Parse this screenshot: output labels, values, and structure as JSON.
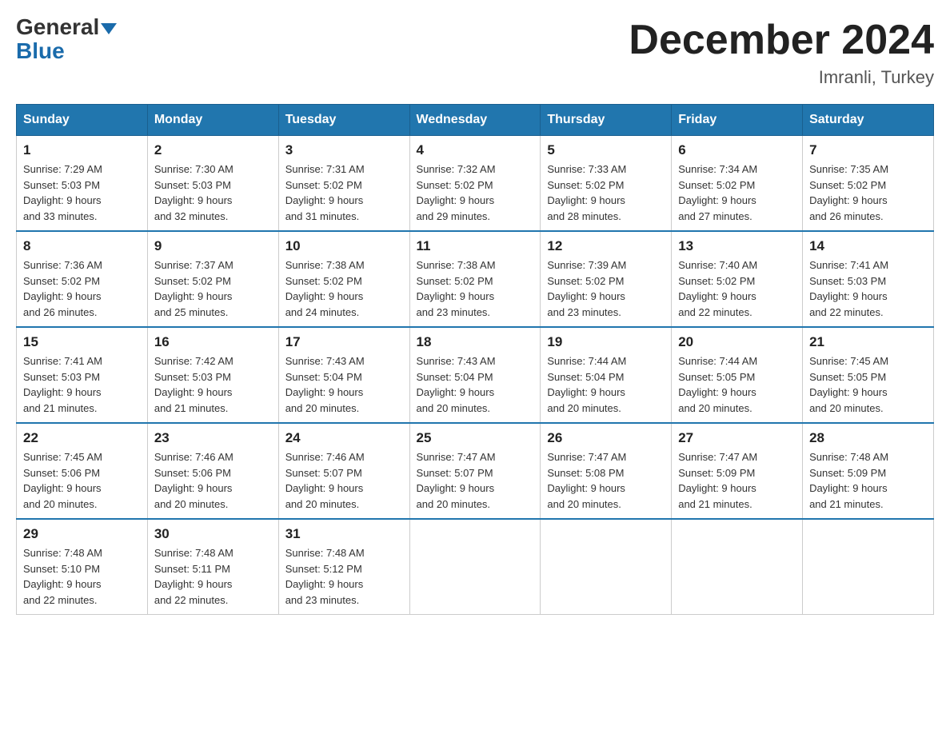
{
  "header": {
    "logo_line1": "General",
    "logo_line2": "Blue",
    "month_title": "December 2024",
    "location": "Imranli, Turkey"
  },
  "weekdays": [
    "Sunday",
    "Monday",
    "Tuesday",
    "Wednesday",
    "Thursday",
    "Friday",
    "Saturday"
  ],
  "weeks": [
    [
      {
        "day": "1",
        "sunrise": "7:29 AM",
        "sunset": "5:03 PM",
        "daylight": "9 hours and 33 minutes."
      },
      {
        "day": "2",
        "sunrise": "7:30 AM",
        "sunset": "5:03 PM",
        "daylight": "9 hours and 32 minutes."
      },
      {
        "day": "3",
        "sunrise": "7:31 AM",
        "sunset": "5:02 PM",
        "daylight": "9 hours and 31 minutes."
      },
      {
        "day": "4",
        "sunrise": "7:32 AM",
        "sunset": "5:02 PM",
        "daylight": "9 hours and 29 minutes."
      },
      {
        "day": "5",
        "sunrise": "7:33 AM",
        "sunset": "5:02 PM",
        "daylight": "9 hours and 28 minutes."
      },
      {
        "day": "6",
        "sunrise": "7:34 AM",
        "sunset": "5:02 PM",
        "daylight": "9 hours and 27 minutes."
      },
      {
        "day": "7",
        "sunrise": "7:35 AM",
        "sunset": "5:02 PM",
        "daylight": "9 hours and 26 minutes."
      }
    ],
    [
      {
        "day": "8",
        "sunrise": "7:36 AM",
        "sunset": "5:02 PM",
        "daylight": "9 hours and 26 minutes."
      },
      {
        "day": "9",
        "sunrise": "7:37 AM",
        "sunset": "5:02 PM",
        "daylight": "9 hours and 25 minutes."
      },
      {
        "day": "10",
        "sunrise": "7:38 AM",
        "sunset": "5:02 PM",
        "daylight": "9 hours and 24 minutes."
      },
      {
        "day": "11",
        "sunrise": "7:38 AM",
        "sunset": "5:02 PM",
        "daylight": "9 hours and 23 minutes."
      },
      {
        "day": "12",
        "sunrise": "7:39 AM",
        "sunset": "5:02 PM",
        "daylight": "9 hours and 23 minutes."
      },
      {
        "day": "13",
        "sunrise": "7:40 AM",
        "sunset": "5:02 PM",
        "daylight": "9 hours and 22 minutes."
      },
      {
        "day": "14",
        "sunrise": "7:41 AM",
        "sunset": "5:03 PM",
        "daylight": "9 hours and 22 minutes."
      }
    ],
    [
      {
        "day": "15",
        "sunrise": "7:41 AM",
        "sunset": "5:03 PM",
        "daylight": "9 hours and 21 minutes."
      },
      {
        "day": "16",
        "sunrise": "7:42 AM",
        "sunset": "5:03 PM",
        "daylight": "9 hours and 21 minutes."
      },
      {
        "day": "17",
        "sunrise": "7:43 AM",
        "sunset": "5:04 PM",
        "daylight": "9 hours and 20 minutes."
      },
      {
        "day": "18",
        "sunrise": "7:43 AM",
        "sunset": "5:04 PM",
        "daylight": "9 hours and 20 minutes."
      },
      {
        "day": "19",
        "sunrise": "7:44 AM",
        "sunset": "5:04 PM",
        "daylight": "9 hours and 20 minutes."
      },
      {
        "day": "20",
        "sunrise": "7:44 AM",
        "sunset": "5:05 PM",
        "daylight": "9 hours and 20 minutes."
      },
      {
        "day": "21",
        "sunrise": "7:45 AM",
        "sunset": "5:05 PM",
        "daylight": "9 hours and 20 minutes."
      }
    ],
    [
      {
        "day": "22",
        "sunrise": "7:45 AM",
        "sunset": "5:06 PM",
        "daylight": "9 hours and 20 minutes."
      },
      {
        "day": "23",
        "sunrise": "7:46 AM",
        "sunset": "5:06 PM",
        "daylight": "9 hours and 20 minutes."
      },
      {
        "day": "24",
        "sunrise": "7:46 AM",
        "sunset": "5:07 PM",
        "daylight": "9 hours and 20 minutes."
      },
      {
        "day": "25",
        "sunrise": "7:47 AM",
        "sunset": "5:07 PM",
        "daylight": "9 hours and 20 minutes."
      },
      {
        "day": "26",
        "sunrise": "7:47 AM",
        "sunset": "5:08 PM",
        "daylight": "9 hours and 20 minutes."
      },
      {
        "day": "27",
        "sunrise": "7:47 AM",
        "sunset": "5:09 PM",
        "daylight": "9 hours and 21 minutes."
      },
      {
        "day": "28",
        "sunrise": "7:48 AM",
        "sunset": "5:09 PM",
        "daylight": "9 hours and 21 minutes."
      }
    ],
    [
      {
        "day": "29",
        "sunrise": "7:48 AM",
        "sunset": "5:10 PM",
        "daylight": "9 hours and 22 minutes."
      },
      {
        "day": "30",
        "sunrise": "7:48 AM",
        "sunset": "5:11 PM",
        "daylight": "9 hours and 22 minutes."
      },
      {
        "day": "31",
        "sunrise": "7:48 AM",
        "sunset": "5:12 PM",
        "daylight": "9 hours and 23 minutes."
      },
      null,
      null,
      null,
      null
    ]
  ]
}
